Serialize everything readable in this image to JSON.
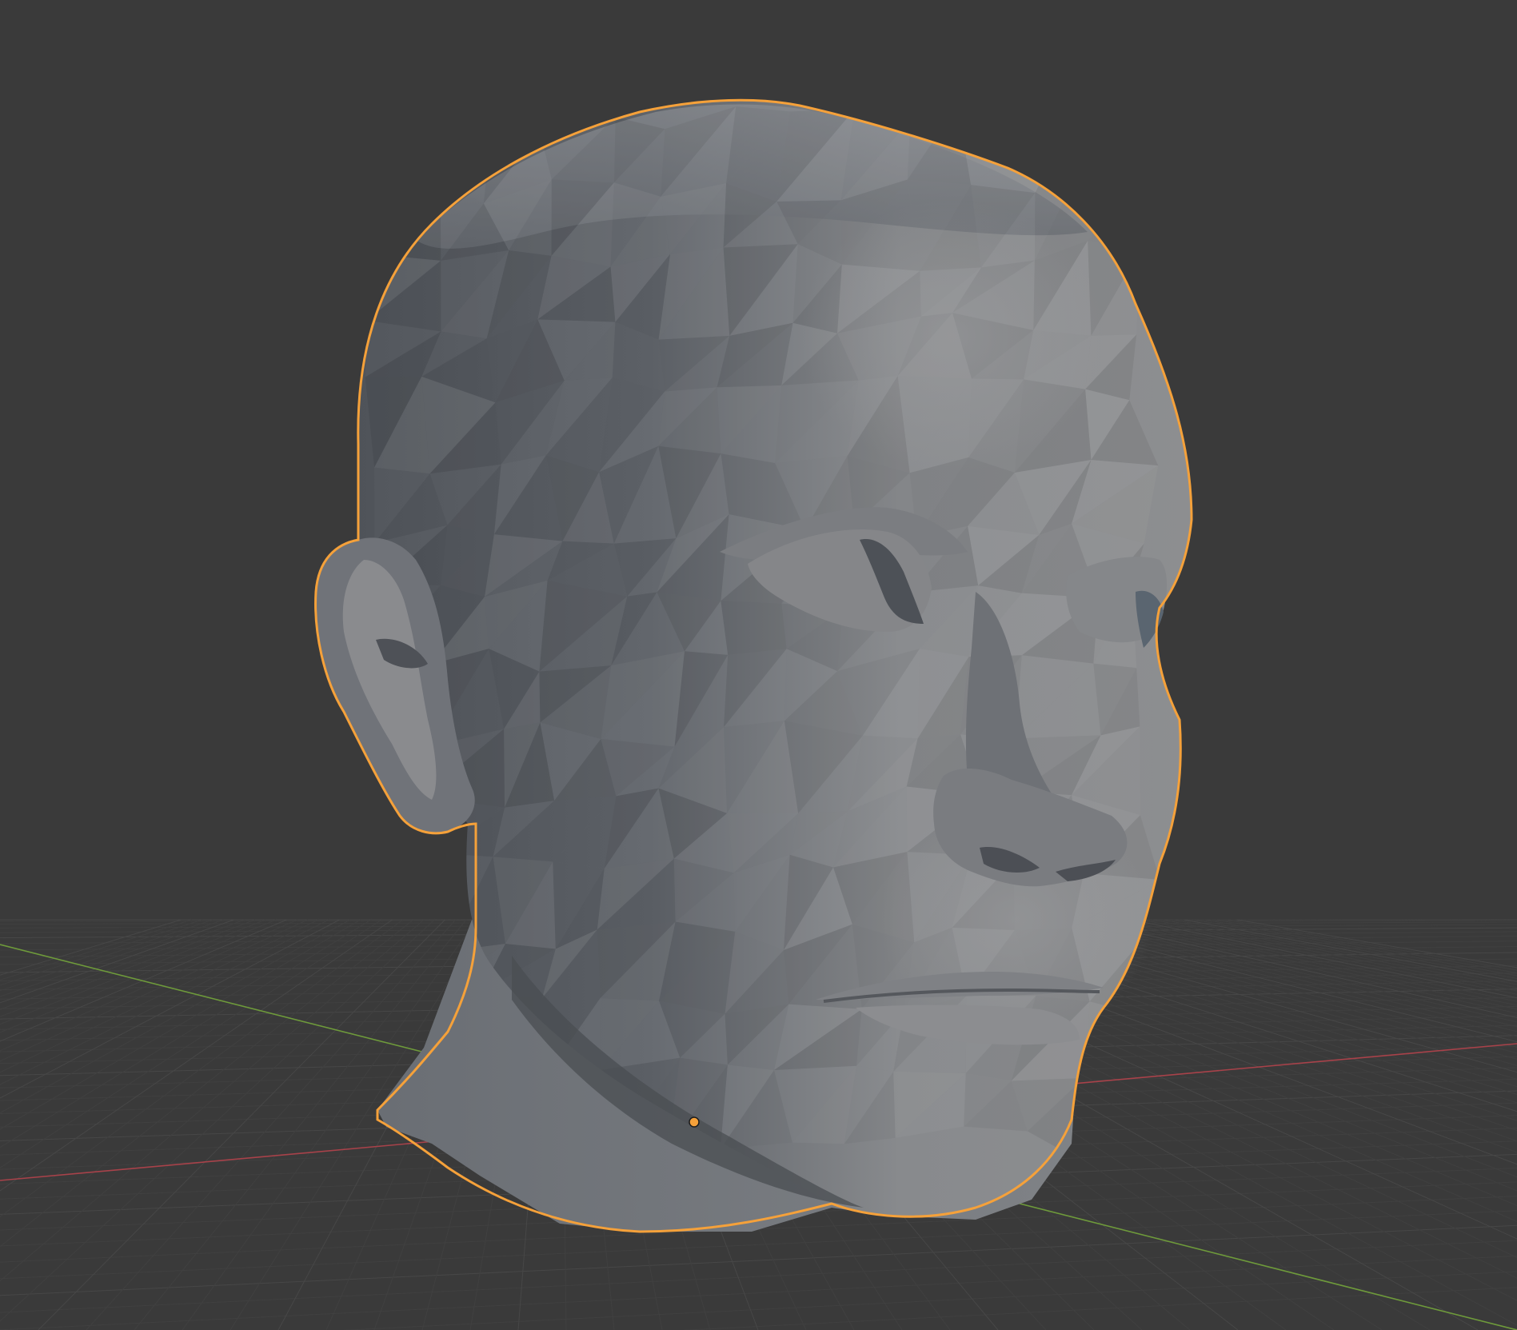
{
  "viewport": {
    "background_color": "#3a3a3a",
    "grid_line_color": "#474747",
    "grid_minor_color": "#404040",
    "x_axis_color": "#a8424a",
    "y_axis_color": "#6e9a3b",
    "selection_outline_color": "#f5a13a",
    "origin_dot_color": "#f5a13a"
  },
  "object": {
    "kind": "mesh",
    "description_icon": "mesh-head-icon",
    "shading": "solid",
    "base_color": "#8a8c90",
    "shadow_color": "#5c5f65",
    "selected": true
  }
}
